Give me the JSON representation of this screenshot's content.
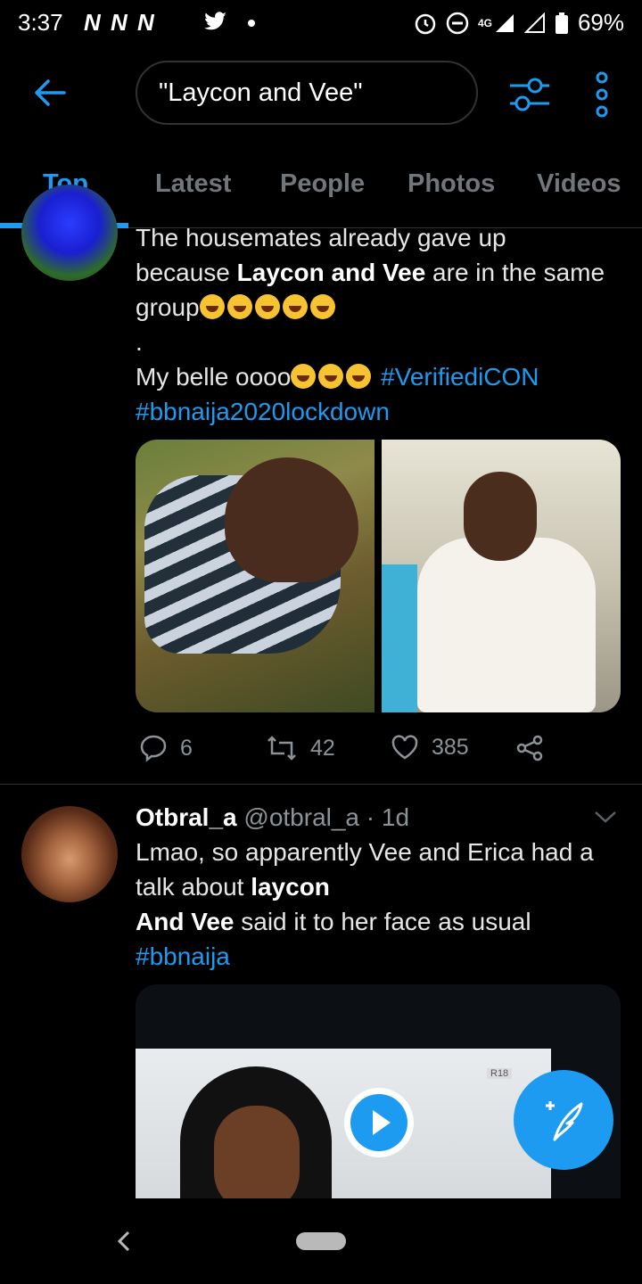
{
  "status_bar": {
    "time": "3:37",
    "notifications": "N N N",
    "network": "4G",
    "battery": "69%"
  },
  "topbar": {
    "search_value": "\"Laycon and Vee\""
  },
  "tabs": [
    {
      "label": "Top",
      "active": true
    },
    {
      "label": "Latest",
      "active": false
    },
    {
      "label": "People",
      "active": false
    },
    {
      "label": "Photos",
      "active": false
    },
    {
      "label": "Videos",
      "active": false
    }
  ],
  "tweet1": {
    "line1": "The housemates already gave up",
    "line2_pre": "because ",
    "line2_bold": "Laycon and Vee",
    "line2_post": " are in the same",
    "line3": "group",
    "line4": ".",
    "line5": "My belle oooo",
    "hashtag1": "#VerifiediCON",
    "hashtag2": "#bbnaija2020lockdown",
    "replies": "6",
    "retweets": "42",
    "likes": "385"
  },
  "tweet2": {
    "name": "Otbral_a",
    "handle": "@otbral_a",
    "time": "· 1d",
    "line1": "Lmao, so apparently Vee and Erica had a",
    "line2_pre": "talk about ",
    "line2_bold": "laycon",
    "line3_bold": "And Vee",
    "line3_post": " said it to her face as usual",
    "hashtag": "#bbnaija",
    "video_badge": "R18"
  },
  "colors": {
    "accent": "#1d9bf0",
    "muted": "#71767b",
    "background": "#000000"
  }
}
